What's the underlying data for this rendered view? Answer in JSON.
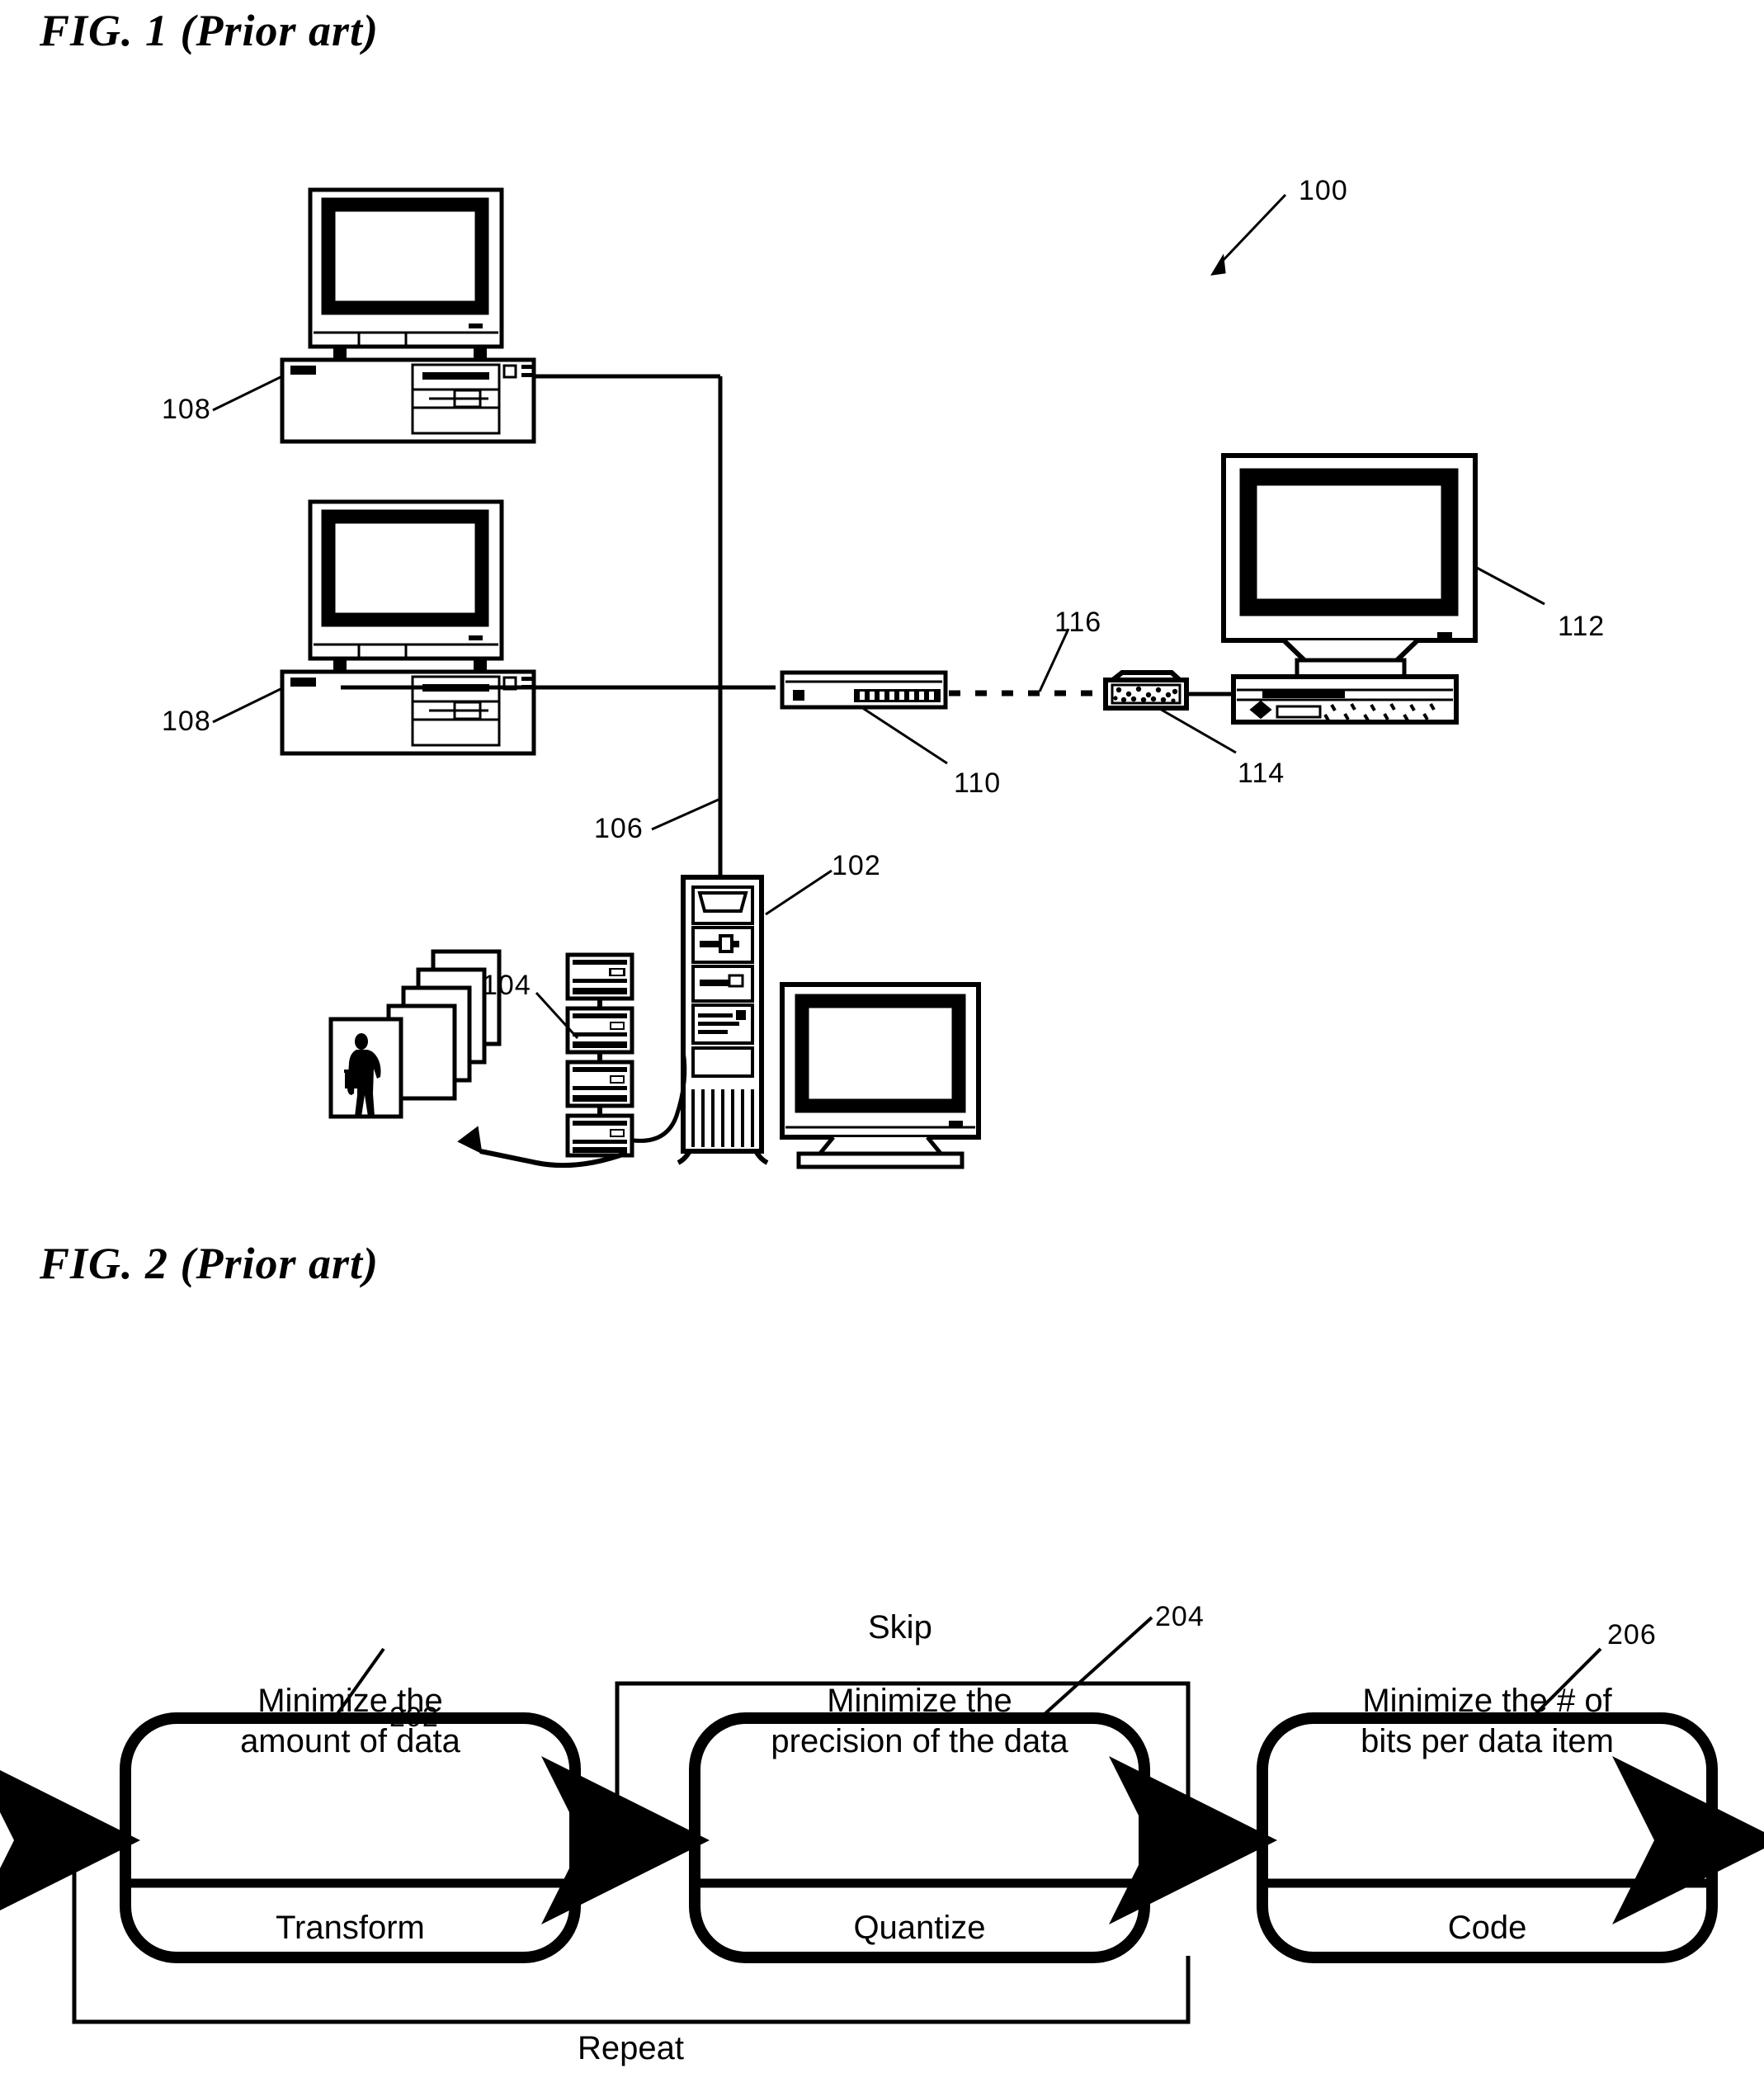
{
  "figures": [
    {
      "id": "fig1",
      "title": "FIG. 1 (Prior art)"
    },
    {
      "id": "fig2",
      "title": "FIG. 2 (Prior art)"
    }
  ],
  "fig1": {
    "title": "FIG. 1 (Prior art)",
    "reference_numerals": [
      {
        "label": "100",
        "target": "overall-system"
      },
      {
        "label": "108",
        "target": "client-workstation-top"
      },
      {
        "label": "108",
        "target": "client-workstation-bottom"
      },
      {
        "label": "112",
        "target": "remote-computer"
      },
      {
        "label": "116",
        "target": "wireless-link"
      },
      {
        "label": "110",
        "target": "network-hub"
      },
      {
        "label": "114",
        "target": "modem"
      },
      {
        "label": "106",
        "target": "network-cable"
      },
      {
        "label": "102",
        "target": "server-tower"
      },
      {
        "label": "104",
        "target": "disk-array"
      }
    ],
    "components": [
      {
        "name": "client-workstation-top",
        "numeral": "108"
      },
      {
        "name": "client-workstation-bottom",
        "numeral": "108"
      },
      {
        "name": "network-hub",
        "numeral": "110"
      },
      {
        "name": "wireless-link",
        "numeral": "116"
      },
      {
        "name": "modem",
        "numeral": "114"
      },
      {
        "name": "remote-computer",
        "numeral": "112"
      },
      {
        "name": "network-cable",
        "numeral": "106"
      },
      {
        "name": "server-tower",
        "numeral": "102"
      },
      {
        "name": "disk-array",
        "numeral": "104"
      },
      {
        "name": "image-stack",
        "numeral": ""
      }
    ]
  },
  "fig2": {
    "title": "FIG. 2 (Prior art)",
    "stages": [
      {
        "numeral": "202",
        "top_line_1": "Minimize the",
        "top_line_2": "amount of data",
        "bottom": "Transform"
      },
      {
        "numeral": "204",
        "top_line_1": "Minimize the",
        "top_line_2": "precision of the data",
        "bottom": "Quantize"
      },
      {
        "numeral": "206",
        "top_line_1": "Minimize the # of",
        "top_line_2": "bits per data item",
        "bottom": "Code"
      }
    ],
    "path_labels": {
      "skip": "Skip",
      "repeat": "Repeat"
    }
  },
  "colors": {
    "ink": "#000000",
    "paper": "#ffffff"
  }
}
